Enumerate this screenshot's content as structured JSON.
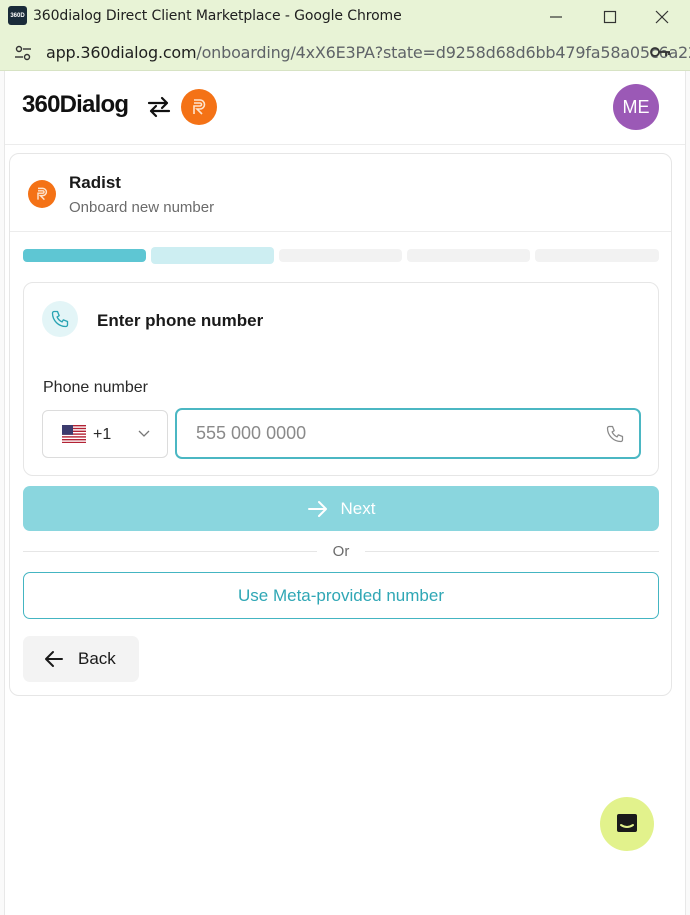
{
  "window": {
    "title": "360dialog Direct Client Marketplace - Google Chrome",
    "app_icon_text": "360D"
  },
  "address_bar": {
    "domain": "app.360dialog.com",
    "path": "/onboarding/4xX6E3PA?state=d9258d68d6bb479fa58a05c6a22..."
  },
  "header": {
    "logo": "360Dialog",
    "avatar_initials": "ME",
    "brand_color": "#f47216",
    "avatar_color": "#9b59b6"
  },
  "client": {
    "name": "Radist",
    "subtitle": "Onboard new number"
  },
  "progress": {
    "total_steps": 5,
    "current_step": 2,
    "colors": {
      "done": "#5ec6d3",
      "current": "#cdeef2",
      "todo": "#f2f2f2"
    }
  },
  "form": {
    "title": "Enter phone number",
    "phone_label": "Phone number",
    "country_code": "+1",
    "country_flag": "us-flag-icon",
    "phone_value": "",
    "phone_placeholder": "555 000 0000"
  },
  "actions": {
    "next_label": "Next",
    "or_label": "Or",
    "meta_label": "Use Meta-provided number",
    "back_label": "Back",
    "accent_color": "#4bb7c3",
    "next_disabled_color": "#8ad6de"
  },
  "chat_widget": {
    "icon": "chat-icon",
    "color": "#e2f28c"
  }
}
